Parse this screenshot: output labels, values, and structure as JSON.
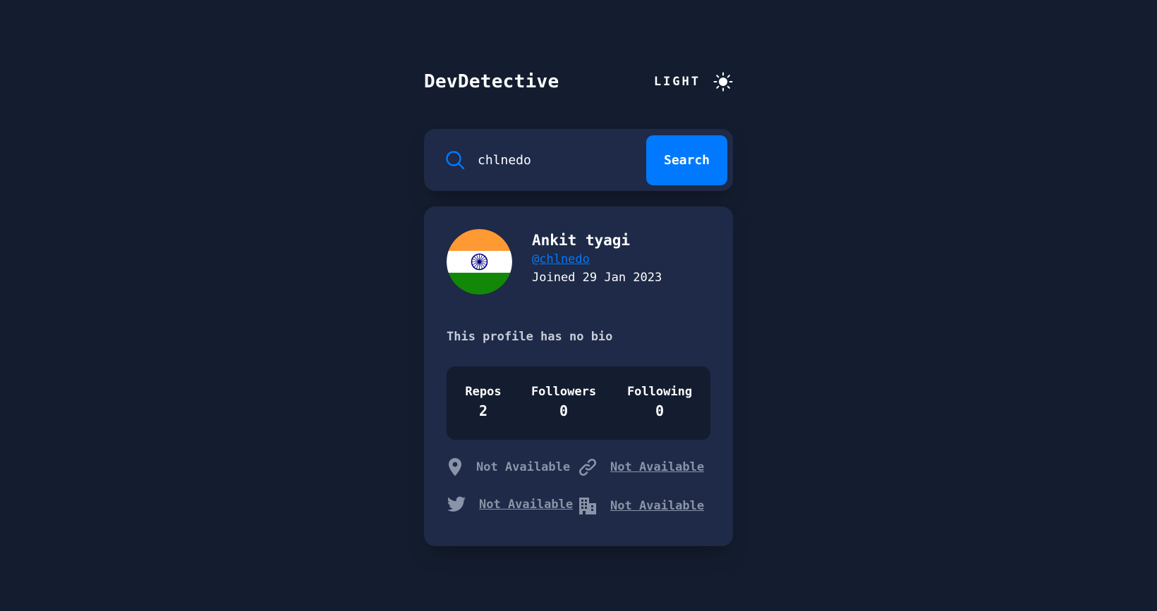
{
  "header": {
    "logo": "DevDetective",
    "theme_label": "LIGHT",
    "theme_icon": "sun-icon"
  },
  "search": {
    "value": "chlnedo",
    "placeholder": "",
    "button_label": "Search",
    "icon": "search-icon"
  },
  "profile": {
    "name": "Ankit tyagi",
    "login": "@chlnedo",
    "joined": "Joined 29 Jan 2023",
    "bio": "This profile has no bio",
    "avatar": "india-flag-avatar",
    "stats": [
      {
        "label": "Repos",
        "value": "2"
      },
      {
        "label": "Followers",
        "value": "0"
      },
      {
        "label": "Following",
        "value": "0"
      }
    ],
    "links": {
      "location": {
        "icon": "location-pin-icon",
        "text": "Not Available"
      },
      "website": {
        "icon": "link-icon",
        "text": "Not Available"
      },
      "twitter": {
        "icon": "twitter-icon",
        "text": "Not Available"
      },
      "company": {
        "icon": "building-icon",
        "text": "Not Available"
      }
    }
  },
  "colors": {
    "background": "#141d2f",
    "card": "#1e2a47",
    "accent": "#0079ff",
    "muted": "#8a93a7"
  }
}
